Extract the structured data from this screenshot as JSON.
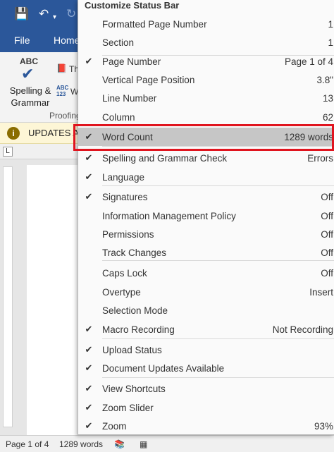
{
  "app": {
    "quick_access": {
      "save_icon": "save-icon",
      "undo_icon": "undo-icon",
      "redo_icon": "redo-icon"
    },
    "tabs": [
      "File",
      "Home"
    ],
    "ribbon": {
      "abc_text": "ABC",
      "spelling_label_1": "Spelling &",
      "spelling_label_2": "Grammar",
      "thesaurus_partial": "Th",
      "abc123_text": "ABC\n123",
      "wordcount_partial": "W",
      "group_label": "Proofing"
    },
    "infobar": {
      "text": "UPDATES A"
    },
    "statusbar": {
      "page": "Page 1 of 4",
      "words": "1289 words"
    }
  },
  "menu": {
    "title": "Customize Status Bar",
    "items": [
      {
        "label": "Formatted Page Number",
        "value": "1",
        "checked": false
      },
      {
        "label": "Section",
        "value": "1",
        "checked": false
      },
      {
        "label": "Page Number",
        "value": "Page 1 of 4",
        "checked": true
      },
      {
        "label": "Vertical Page Position",
        "value": "3.8\"",
        "checked": false
      },
      {
        "label": "Line Number",
        "value": "13",
        "checked": false
      },
      {
        "label": "Column",
        "value": "62",
        "checked": false
      },
      {
        "label": "Word Count",
        "value": "1289 words",
        "checked": true,
        "highlighted": true
      },
      {
        "label": "Spelling and Grammar Check",
        "value": "Errors",
        "checked": true
      },
      {
        "label": "Language",
        "value": "",
        "checked": true
      },
      {
        "label": "Signatures",
        "value": "Off",
        "checked": true
      },
      {
        "label": "Information Management Policy",
        "value": "Off",
        "checked": false
      },
      {
        "label": "Permissions",
        "value": "Off",
        "checked": false
      },
      {
        "label": "Track Changes",
        "value": "Off",
        "checked": false
      },
      {
        "label": "Caps Lock",
        "value": "Off",
        "checked": false
      },
      {
        "label": "Overtype",
        "value": "Insert",
        "checked": false
      },
      {
        "label": "Selection Mode",
        "value": "",
        "checked": false
      },
      {
        "label": "Macro Recording",
        "value": "Not Recording",
        "checked": true
      },
      {
        "label": "Upload Status",
        "value": "",
        "checked": true
      },
      {
        "label": "Document Updates Available",
        "value": "",
        "checked": true
      },
      {
        "label": "View Shortcuts",
        "value": "",
        "checked": true
      },
      {
        "label": "Zoom Slider",
        "value": "",
        "checked": true
      },
      {
        "label": "Zoom",
        "value": "93%",
        "checked": true
      }
    ]
  },
  "colors": {
    "accent": "#2b579a",
    "highlight": "#c6c6c6",
    "callout": "#e0141e"
  }
}
